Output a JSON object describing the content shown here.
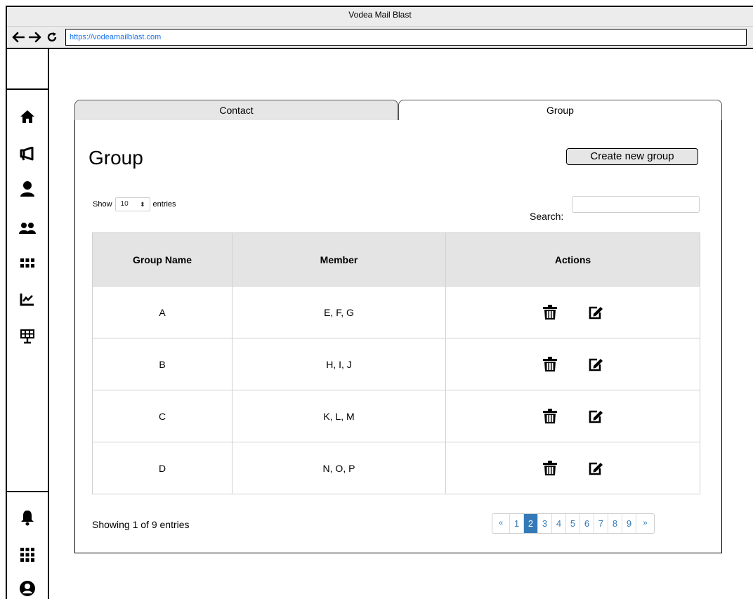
{
  "window": {
    "title": "Vodea Mail Blast"
  },
  "browser": {
    "url": "https://vodeamailblast.com"
  },
  "sidebar": {
    "top_icons": [
      "home-icon",
      "megaphone-icon",
      "user-icon",
      "users-icon",
      "grid-icon",
      "chart-line-icon",
      "solar-panel-icon"
    ],
    "bottom_icons": [
      "bell-icon",
      "apps-grid-icon",
      "user-circle-icon"
    ]
  },
  "tabs": [
    {
      "label": "Contact",
      "active": false
    },
    {
      "label": "Group",
      "active": true
    }
  ],
  "page": {
    "title": "Group",
    "create_button": "Create new group",
    "show_label": "Show",
    "entries_value": "10",
    "entries_label": "entries",
    "search_label": "Search:",
    "search_value": ""
  },
  "table": {
    "headers": [
      "Group Name",
      "Member",
      "Actions"
    ],
    "rows": [
      {
        "name": "A",
        "members": "E, F, G"
      },
      {
        "name": "B",
        "members": "H, I, J"
      },
      {
        "name": "C",
        "members": "K, L, M"
      },
      {
        "name": "D",
        "members": "N, O, P"
      }
    ]
  },
  "footer": {
    "showing_text": "Showing 1 of 9 entries",
    "pagination": {
      "prev": "«",
      "next": "»",
      "pages": [
        "1",
        "2",
        "3",
        "4",
        "5",
        "6",
        "7",
        "8",
        "9"
      ],
      "current": "2"
    }
  },
  "colors": {
    "accent": "#337ab7",
    "header_bg": "#e4e4e4",
    "tab_inactive": "#e6e6e6"
  }
}
